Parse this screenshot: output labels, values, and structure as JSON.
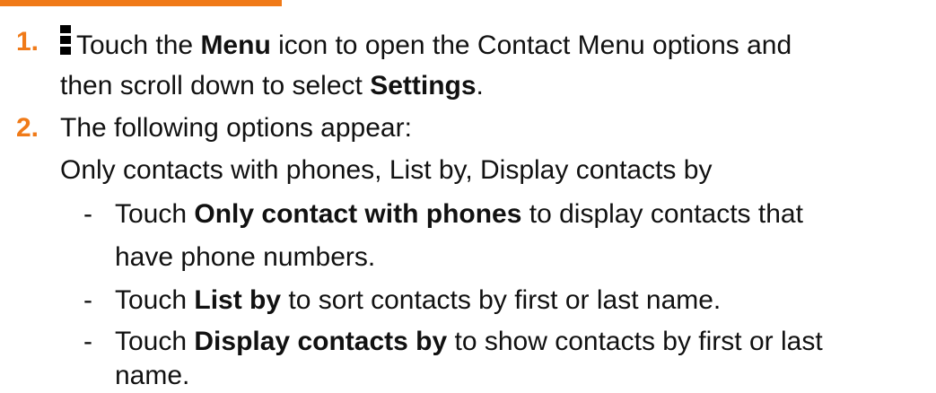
{
  "steps": [
    {
      "number": "1.",
      "lines": [
        {
          "parts": [
            "Touch the ",
            "Menu",
            " icon to open the Contact Menu options and"
          ]
        },
        {
          "parts": [
            "then scroll down to select ",
            "Settings",
            "."
          ]
        }
      ],
      "icon": "vertical-dots-menu-icon"
    },
    {
      "number": "2.",
      "intro": "The following options appear:",
      "options_line": "Only contacts with phones, List by, Display contacts by",
      "bullets": [
        {
          "dash": "-",
          "pre": "Touch ",
          "bold": "Only contact with phones",
          "post": " to display contacts that",
          "cont": "have phone numbers."
        },
        {
          "dash": "-",
          "pre": "Touch ",
          "bold": "List by",
          "post": " to sort contacts by first or last name."
        },
        {
          "dash": "-",
          "pre": "Touch ",
          "bold": "Display contacts by",
          "post": " to show contacts by first or last",
          "cont": "name."
        }
      ]
    }
  ],
  "colors": {
    "accent": "#f07a18",
    "text": "#111111"
  }
}
